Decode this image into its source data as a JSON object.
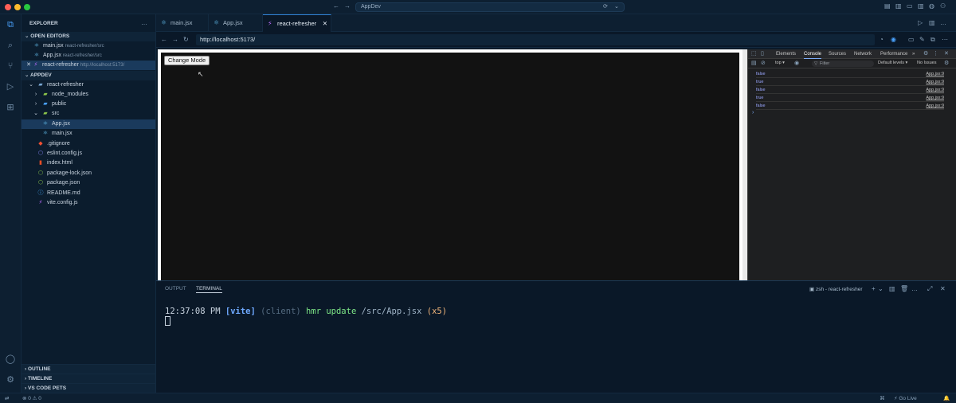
{
  "window": {
    "title": "AppDev"
  },
  "colors": {
    "accent": "#2f7fd1",
    "link": "#7cacf8",
    "vite_accent": "#6ea8fe",
    "hmr_green": "#7ee787",
    "count_orange": "#f0b47a"
  },
  "sidebar": {
    "explorer_label": "EXPLORER",
    "open_editors_label": "OPEN EDITORS",
    "open_editors": [
      {
        "name": "main.jsx",
        "path": "react-refresher/src",
        "icon": "react-icon"
      },
      {
        "name": "App.jsx",
        "path": "react-refresher/src",
        "icon": "react-icon"
      },
      {
        "name": "react-refresher",
        "path": "http://localhost:5173/",
        "icon": "vite-icon"
      }
    ],
    "workspace_label": "APPDEV",
    "tree": [
      {
        "name": "react-refresher",
        "icon": "folder-open-icon"
      },
      {
        "name": "node_modules",
        "icon": "folder-icon"
      },
      {
        "name": "public",
        "icon": "folder-icon"
      },
      {
        "name": "src",
        "icon": "folder-open-icon"
      },
      {
        "name": "App.jsx",
        "icon": "react-icon"
      },
      {
        "name": "main.jsx",
        "icon": "react-icon"
      },
      {
        "name": ".gitignore",
        "icon": "git-icon"
      },
      {
        "name": "eslint.config.js",
        "icon": "eslint-icon"
      },
      {
        "name": "index.html",
        "icon": "html-icon"
      },
      {
        "name": "package-lock.json",
        "icon": "npm-icon"
      },
      {
        "name": "package.json",
        "icon": "npm-icon"
      },
      {
        "name": "README.md",
        "icon": "info-icon"
      },
      {
        "name": "vite.config.js",
        "icon": "vite-icon"
      }
    ],
    "bottom_sections": [
      "OUTLINE",
      "TIMELINE",
      "VS CODE PETS"
    ]
  },
  "tabs": [
    {
      "label": "main.jsx",
      "icon": "react-icon"
    },
    {
      "label": "App.jsx",
      "icon": "react-icon"
    },
    {
      "label": "react-refresher",
      "icon": "vite-icon",
      "active": true
    }
  ],
  "browser": {
    "url": "http://localhost:5173/",
    "button_label": "Change Mode"
  },
  "devtools": {
    "tabs": [
      "Elements",
      "Console",
      "Sources",
      "Network",
      "Performance"
    ],
    "active_tab": "Console",
    "context": "top",
    "filter_placeholder": "Filter",
    "levels": "Default levels",
    "issues": "No Issues",
    "logs": [
      {
        "value": "false",
        "source": "App.jsx:9"
      },
      {
        "value": "true",
        "source": "App.jsx:9"
      },
      {
        "value": "false",
        "source": "App.jsx:9"
      },
      {
        "value": "true",
        "source": "App.jsx:9"
      },
      {
        "value": "false",
        "source": "App.jsx:9"
      }
    ],
    "prompt": "›"
  },
  "panel": {
    "tabs": [
      "OUTPUT",
      "TERMINAL"
    ],
    "active_tab": "TERMINAL",
    "terminal_name": "zsh - react-refresher",
    "line": {
      "time": "12:37:08 PM",
      "tag": "[vite]",
      "scope": "(client)",
      "action": "hmr update",
      "path": "/src/App.jsx",
      "count": "(x5)"
    }
  },
  "status": {
    "problems": "⊗ 0 ⚠ 0",
    "go_live": "⚡ Go Live"
  }
}
